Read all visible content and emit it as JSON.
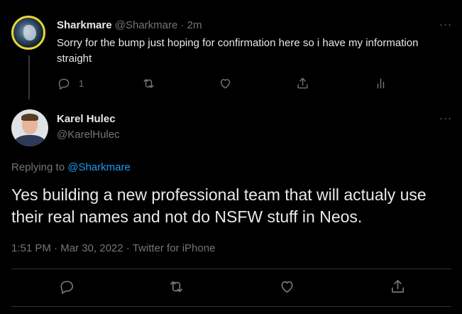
{
  "reply_tweet": {
    "display_name": "Sharkmare",
    "handle": "@Sharkmare",
    "separator": "·",
    "time": "2m",
    "text": "Sorry for the bump just hoping for confirmation here so i have my information straight",
    "reply_count": "1",
    "more_label": "···"
  },
  "main_tweet": {
    "display_name": "Karel Hulec",
    "handle": "@KarelHulec",
    "replying_prefix": "Replying to",
    "replying_to": "@Sharkmare",
    "text": "Yes building a new professional team that will actualy use their real names and not do NSFW stuff in Neos.",
    "time": "1:51 PM",
    "separator1": "·",
    "date": "Mar 30, 2022",
    "separator2": "·",
    "source": "Twitter for iPhone",
    "more_label": "···"
  },
  "icons": {
    "reply": "reply-icon",
    "retweet": "retweet-icon",
    "like": "heart-icon",
    "share": "share-icon",
    "analytics": "analytics-icon",
    "more": "more-icon"
  },
  "colors": {
    "background": "#000000",
    "text": "#e7e9ea",
    "secondary": "#71767b",
    "link": "#1d9bf0",
    "divider": "#2f3336",
    "avatar_ring": "#e7d635"
  }
}
